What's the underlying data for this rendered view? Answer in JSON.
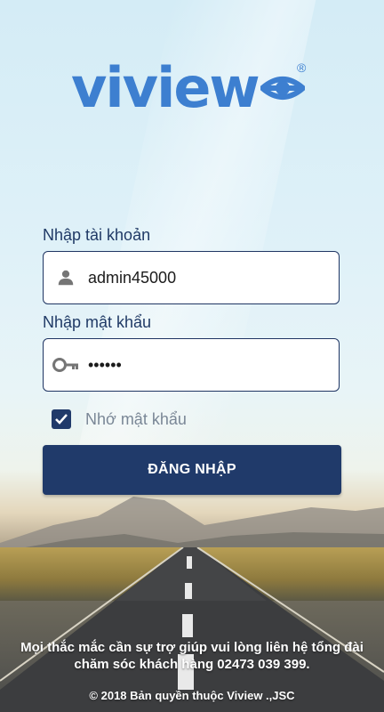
{
  "brand": {
    "name": "viview",
    "registered": "®"
  },
  "form": {
    "username_label": "Nhập tài khoản",
    "username_value": "admin45000",
    "password_label": "Nhập mật khẩu",
    "password_value": "••••••",
    "remember_label": "Nhớ mật khẩu",
    "remember_checked": true,
    "login_button": "ĐĂNG NHẬP"
  },
  "footer": {
    "support_text": "Mọi thắc mắc cần sự trợ giúp vui lòng liên hệ tổng đài chăm sóc khách hàng 02473 039 399.",
    "copyright": "© 2018 Bản quyền thuộc Viview .,JSC"
  },
  "icons": {
    "username": "person-icon",
    "password": "key-icon",
    "remember": "checkbox-checked-icon"
  },
  "colors": {
    "primary": "#203a6a",
    "brand_blue": "#3d7fd0"
  }
}
